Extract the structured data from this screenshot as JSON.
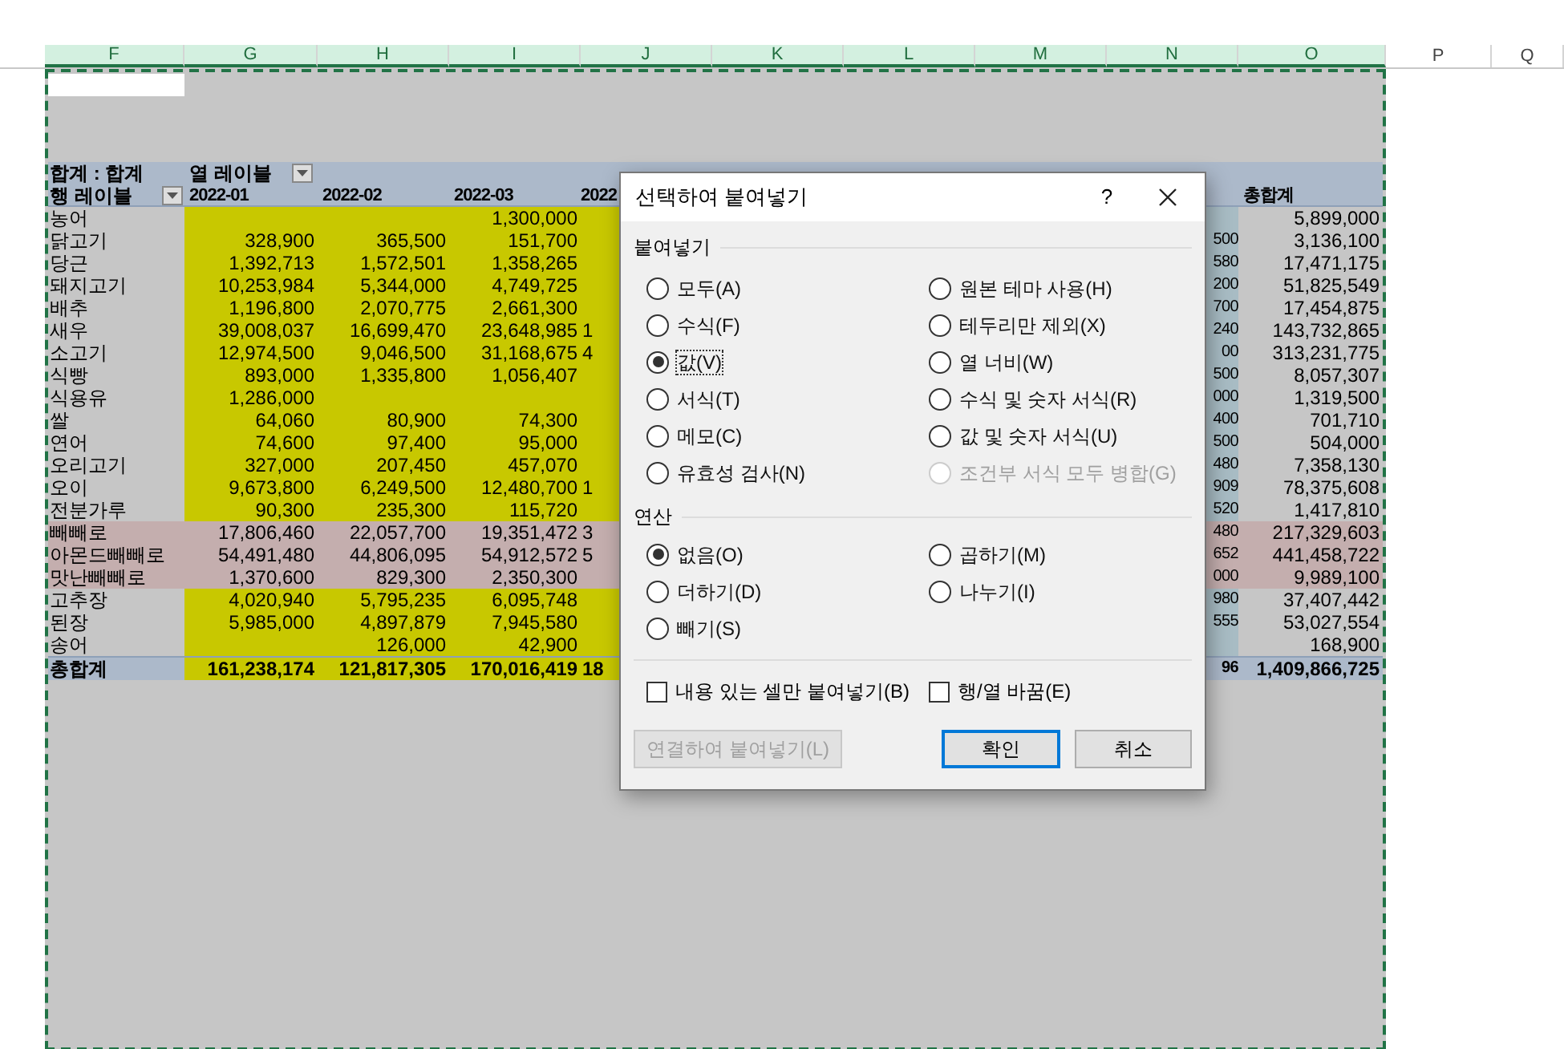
{
  "column_headers": [
    {
      "label": "F",
      "selected": true
    },
    {
      "label": "G",
      "selected": true
    },
    {
      "label": "H",
      "selected": true
    },
    {
      "label": "I",
      "selected": true
    },
    {
      "label": "J",
      "selected": true
    },
    {
      "label": "K",
      "selected": true
    },
    {
      "label": "L",
      "selected": true
    },
    {
      "label": "M",
      "selected": true
    },
    {
      "label": "N",
      "selected": true
    },
    {
      "label": "O",
      "selected": true
    },
    {
      "label": "P",
      "selected": false
    },
    {
      "label": "Q",
      "selected": false
    }
  ],
  "pivot": {
    "value_label": "합계 : 합계",
    "column_label": "열 레이블",
    "row_label": "행 레이블",
    "headers": {
      "G": "2022-01",
      "H": "2022-02",
      "I": "2022-03",
      "J": "2022",
      "O": "총합계"
    },
    "rows": [
      {
        "label": "농어",
        "highlighted": false,
        "values": {
          "I": "1,300,000",
          "O": "5,899,000"
        }
      },
      {
        "label": "닭고기",
        "highlighted": false,
        "values": {
          "G": "328,900",
          "H": "365,500",
          "I": "151,700",
          "N": "500",
          "O": "3,136,100"
        }
      },
      {
        "label": "당근",
        "highlighted": false,
        "values": {
          "G": "1,392,713",
          "H": "1,572,501",
          "I": "1,358,265",
          "N": "580",
          "O": "17,471,175"
        }
      },
      {
        "label": "돼지고기",
        "highlighted": false,
        "values": {
          "G": "10,253,984",
          "H": "5,344,000",
          "I": "4,749,725",
          "N": "200",
          "O": "51,825,549"
        }
      },
      {
        "label": "배추",
        "highlighted": false,
        "values": {
          "G": "1,196,800",
          "H": "2,070,775",
          "I": "2,661,300",
          "N": "700",
          "O": "17,454,875"
        }
      },
      {
        "label": "새우",
        "highlighted": false,
        "values": {
          "G": "39,008,037",
          "H": "16,699,470",
          "I": "23,648,985",
          "J": "1",
          "N": "240",
          "O": "143,732,865"
        }
      },
      {
        "label": "소고기",
        "highlighted": false,
        "values": {
          "G": "12,974,500",
          "H": "9,046,500",
          "I": "31,168,675",
          "J": "4",
          "N": "00",
          "O": "313,231,775"
        }
      },
      {
        "label": "식빵",
        "highlighted": false,
        "values": {
          "G": "893,000",
          "H": "1,335,800",
          "I": "1,056,407",
          "N": "500",
          "O": "8,057,307"
        }
      },
      {
        "label": "식용유",
        "highlighted": false,
        "values": {
          "G": "1,286,000",
          "N": "000",
          "O": "1,319,500"
        }
      },
      {
        "label": "쌀",
        "highlighted": false,
        "values": {
          "G": "64,060",
          "H": "80,900",
          "I": "74,300",
          "N": "400",
          "O": "701,710"
        }
      },
      {
        "label": "연어",
        "highlighted": false,
        "values": {
          "G": "74,600",
          "H": "97,400",
          "I": "95,000",
          "N": "500",
          "O": "504,000"
        }
      },
      {
        "label": "오리고기",
        "highlighted": false,
        "values": {
          "G": "327,000",
          "H": "207,450",
          "I": "457,070",
          "N": "480",
          "O": "7,358,130"
        }
      },
      {
        "label": "오이",
        "highlighted": false,
        "values": {
          "G": "9,673,800",
          "H": "6,249,500",
          "I": "12,480,700",
          "J": "1",
          "N": "909",
          "O": "78,375,608"
        }
      },
      {
        "label": "전분가루",
        "highlighted": false,
        "values": {
          "G": "90,300",
          "H": "235,300",
          "I": "115,720",
          "N": "520",
          "O": "1,417,810"
        }
      },
      {
        "label": "빼빼로",
        "highlighted": true,
        "values": {
          "G": "17,806,460",
          "H": "22,057,700",
          "I": "19,351,472",
          "J": "3",
          "N": "480",
          "O": "217,329,603"
        }
      },
      {
        "label": "아몬드빼빼로",
        "highlighted": true,
        "values": {
          "G": "54,491,480",
          "H": "44,806,095",
          "I": "54,912,572",
          "J": "5",
          "N": "652",
          "O": "441,458,722"
        }
      },
      {
        "label": "맛난빼빼로",
        "highlighted": true,
        "values": {
          "G": "1,370,600",
          "H": "829,300",
          "I": "2,350,300",
          "N": "000",
          "O": "9,989,100"
        }
      },
      {
        "label": "고추장",
        "highlighted": false,
        "values": {
          "G": "4,020,940",
          "H": "5,795,235",
          "I": "6,095,748",
          "N": "980",
          "O": "37,407,442"
        }
      },
      {
        "label": "된장",
        "highlighted": false,
        "values": {
          "G": "5,985,000",
          "H": "4,897,879",
          "I": "7,945,580",
          "N": "555",
          "O": "53,027,554"
        }
      },
      {
        "label": "송어",
        "highlighted": false,
        "values": {
          "H": "126,000",
          "I": "42,900",
          "O": "168,900"
        }
      }
    ],
    "total": {
      "label": "총합계",
      "values": {
        "G": "161,238,174",
        "H": "121,817,305",
        "I": "170,016,419",
        "J": "18",
        "N": "96",
        "O": "1,409,866,725"
      }
    }
  },
  "dialog": {
    "title": "선택하여 붙여넣기",
    "help": "?",
    "paste": {
      "title": "붙여넣기",
      "options": [
        {
          "label": "모두(A)",
          "selected": false,
          "disabled": false,
          "focused": false
        },
        {
          "label": "원본 테마 사용(H)",
          "selected": false,
          "disabled": false,
          "focused": false
        },
        {
          "label": "수식(F)",
          "selected": false,
          "disabled": false,
          "focused": false
        },
        {
          "label": "테두리만 제외(X)",
          "selected": false,
          "disabled": false,
          "focused": false
        },
        {
          "label": "값(V)",
          "selected": true,
          "disabled": false,
          "focused": true
        },
        {
          "label": "열 너비(W)",
          "selected": false,
          "disabled": false,
          "focused": false
        },
        {
          "label": "서식(T)",
          "selected": false,
          "disabled": false,
          "focused": false
        },
        {
          "label": "수식 및 숫자 서식(R)",
          "selected": false,
          "disabled": false,
          "focused": false
        },
        {
          "label": "메모(C)",
          "selected": false,
          "disabled": false,
          "focused": false
        },
        {
          "label": "값 및 숫자 서식(U)",
          "selected": false,
          "disabled": false,
          "focused": false
        },
        {
          "label": "유효성 검사(N)",
          "selected": false,
          "disabled": false,
          "focused": false
        },
        {
          "label": "조건부 서식 모두 병합(G)",
          "selected": false,
          "disabled": true,
          "focused": false
        }
      ]
    },
    "operation": {
      "title": "연산",
      "options": [
        {
          "label": "없음(O)",
          "selected": true
        },
        {
          "label": "곱하기(M)",
          "selected": false
        },
        {
          "label": "더하기(D)",
          "selected": false
        },
        {
          "label": "나누기(I)",
          "selected": false
        },
        {
          "label": "빼기(S)",
          "selected": false
        }
      ]
    },
    "checkboxes": [
      {
        "label": "내용 있는 셀만 붙여넣기(B)",
        "checked": false
      },
      {
        "label": "행/열 바꿈(E)",
        "checked": false
      }
    ],
    "buttons": [
      {
        "label": "연결하여 붙여넣기(L)",
        "kind": "link",
        "disabled": true
      },
      {
        "label": "확인",
        "kind": "default",
        "disabled": false
      },
      {
        "label": "취소",
        "kind": "normal",
        "disabled": false
      }
    ]
  }
}
